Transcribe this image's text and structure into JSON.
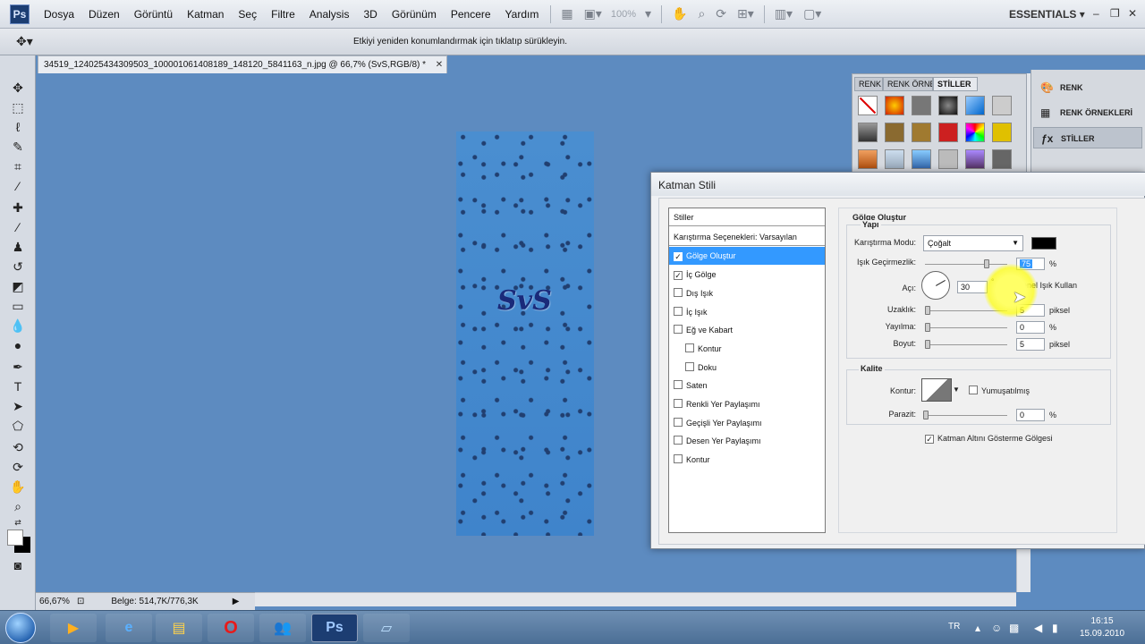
{
  "menubar": {
    "logo": "Ps",
    "items": [
      "Dosya",
      "Düzen",
      "Görüntü",
      "Katman",
      "Seç",
      "Filtre",
      "Analysis",
      "3D",
      "Görünüm",
      "Pencere",
      "Yardım"
    ],
    "zoom": "100%",
    "workspace": "ESSENTIALS"
  },
  "options": {
    "hint": "Etkiyi yeniden konumlandırmak için tıklatıp sürükleyin."
  },
  "document": {
    "tab_title": "34519_124025434309503_100001061408189_148120_5841163_n.jpg @ 66,7% (SvS,RGB/8) *",
    "text_layer": "SvS"
  },
  "status": {
    "zoom": "66,67%",
    "doc_size": "Belge: 514,7K/776,3K"
  },
  "styles_panel": {
    "tabs": [
      "RENK",
      "RENK ÖRNE",
      "STİLLER"
    ]
  },
  "dock": {
    "items": [
      "RENK",
      "RENK ÖRNEKLERİ",
      "STİLLER"
    ]
  },
  "dialog": {
    "title": "Katman Stili",
    "style_list": {
      "header": "Stiller",
      "blend_options": "Karıştırma Seçenekleri: Varsayılan",
      "items": [
        {
          "label": "Gölge Oluştur",
          "checked": true
        },
        {
          "label": "İç Gölge",
          "checked": true
        },
        {
          "label": "Dış Işık",
          "checked": false
        },
        {
          "label": "İç Işık",
          "checked": false
        },
        {
          "label": "Eğ ve Kabart",
          "checked": false
        },
        {
          "label": "Kontur",
          "checked": false
        },
        {
          "label": "Doku",
          "checked": false
        },
        {
          "label": "Saten",
          "checked": false
        },
        {
          "label": "Renkli Yer Paylaşımı",
          "checked": false
        },
        {
          "label": "Geçişli Yer Paylaşımı",
          "checked": false
        },
        {
          "label": "Desen Yer Paylaşımı",
          "checked": false
        },
        {
          "label": "Kontur",
          "checked": false
        }
      ]
    },
    "settings": {
      "section_title": "Gölge Oluştur",
      "structure_title": "Yapı",
      "blend_mode_label": "Karıştırma Modu:",
      "blend_mode_value": "Çoğalt",
      "opacity_label": "Işık Geçirmezlik:",
      "opacity_value": "75",
      "opacity_unit": "%",
      "angle_label": "Açı:",
      "angle_value": "30",
      "angle_unit": "°",
      "global_light_label": "Genel Işık Kullan",
      "distance_label": "Uzaklık:",
      "distance_value": "5",
      "distance_unit": "piksel",
      "spread_label": "Yayılma:",
      "spread_value": "0",
      "spread_unit": "%",
      "size_label": "Boyut:",
      "size_value": "5",
      "size_unit": "piksel",
      "quality_title": "Kalite",
      "contour_label": "Kontur:",
      "antialias_label": "Yumuşatılmış",
      "noise_label": "Parazit:",
      "noise_value": "0",
      "noise_unit": "%",
      "knockout_label": "Katman Altını Gösterme Gölgesi"
    }
  },
  "taskbar": {
    "photoshop_label": "Ps",
    "lang": "TR",
    "time": "16:15",
    "date": "15.09.2010"
  }
}
